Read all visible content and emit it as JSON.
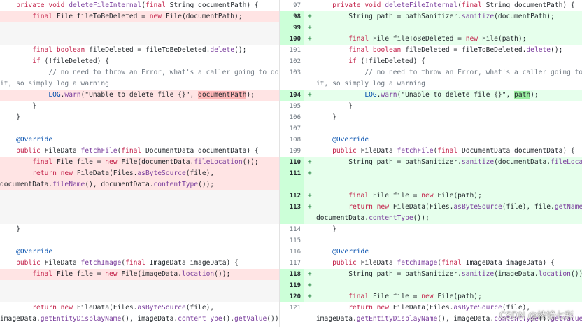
{
  "diff": {
    "left_rows": [
      {
        "type": "context",
        "tokens": [
          {
            "t": "    "
          },
          {
            "t": "private",
            "c": "k"
          },
          {
            "t": " "
          },
          {
            "t": "void",
            "c": "k"
          },
          {
            "t": " "
          },
          {
            "t": "deleteFileInternal",
            "c": "fn"
          },
          {
            "t": "("
          },
          {
            "t": "final",
            "c": "k"
          },
          {
            "t": " String documentPath) {"
          }
        ]
      },
      {
        "type": "removed",
        "tokens": [
          {
            "t": "        "
          },
          {
            "t": "final",
            "c": "k"
          },
          {
            "t": " File fileToBeDeleted = "
          },
          {
            "t": "new",
            "c": "k"
          },
          {
            "t": " File(documentPath);"
          }
        ]
      },
      {
        "type": "filler",
        "tokens": []
      },
      {
        "type": "filler",
        "tokens": []
      },
      {
        "type": "context",
        "tokens": [
          {
            "t": "        "
          },
          {
            "t": "final",
            "c": "k"
          },
          {
            "t": " "
          },
          {
            "t": "boolean",
            "c": "k"
          },
          {
            "t": " fileDeleted = fileToBeDeleted."
          },
          {
            "t": "delete",
            "c": "fn"
          },
          {
            "t": "();"
          }
        ]
      },
      {
        "type": "context",
        "tokens": [
          {
            "t": "        "
          },
          {
            "t": "if",
            "c": "k"
          },
          {
            "t": " (!fileDeleted) {"
          }
        ]
      },
      {
        "type": "context",
        "tokens": [
          {
            "t": "            "
          },
          {
            "t": "// no need to throw an Error, what's a caller going to do about",
            "c": "cm"
          }
        ]
      },
      {
        "type": "context",
        "tokens": [
          {
            "t": "it, so simply log a warning",
            "c": "cm"
          }
        ]
      },
      {
        "type": "removed",
        "tokens": [
          {
            "t": "            "
          },
          {
            "t": "LOG",
            "c": "an"
          },
          {
            "t": "."
          },
          {
            "t": "warn",
            "c": "fn"
          },
          {
            "t": "(\"Unable to delete file {}\", "
          },
          {
            "t": "documentPath",
            "c": "hl-del"
          },
          {
            "t": ");"
          }
        ]
      },
      {
        "type": "context",
        "tokens": [
          {
            "t": "        }"
          }
        ]
      },
      {
        "type": "context",
        "tokens": [
          {
            "t": "    }"
          }
        ]
      },
      {
        "type": "context",
        "tokens": [
          {
            "t": ""
          }
        ]
      },
      {
        "type": "context",
        "tokens": [
          {
            "t": "    "
          },
          {
            "t": "@Override",
            "c": "an"
          }
        ]
      },
      {
        "type": "context",
        "tokens": [
          {
            "t": "    "
          },
          {
            "t": "public",
            "c": "k"
          },
          {
            "t": " FileData "
          },
          {
            "t": "fetchFile",
            "c": "fn"
          },
          {
            "t": "("
          },
          {
            "t": "final",
            "c": "k"
          },
          {
            "t": " DocumentData documentData) {"
          }
        ]
      },
      {
        "type": "removed",
        "tokens": [
          {
            "t": "        "
          },
          {
            "t": "final",
            "c": "k"
          },
          {
            "t": " File file = "
          },
          {
            "t": "new",
            "c": "k"
          },
          {
            "t": " File(documentData."
          },
          {
            "t": "fileLocation",
            "c": "fld"
          },
          {
            "t": "());"
          }
        ]
      },
      {
        "type": "removed",
        "tokens": [
          {
            "t": "        "
          },
          {
            "t": "return",
            "c": "k"
          },
          {
            "t": " "
          },
          {
            "t": "new",
            "c": "k"
          },
          {
            "t": " FileData(Files."
          },
          {
            "t": "asByteSource",
            "c": "fn"
          },
          {
            "t": "(file),"
          }
        ]
      },
      {
        "type": "removed",
        "tokens": [
          {
            "t": "documentData."
          },
          {
            "t": "fileName",
            "c": "fld"
          },
          {
            "t": "(), documentData."
          },
          {
            "t": "contentType",
            "c": "fld"
          },
          {
            "t": "());"
          }
        ]
      },
      {
        "type": "filler",
        "tokens": []
      },
      {
        "type": "filler",
        "tokens": []
      },
      {
        "type": "filler",
        "tokens": []
      },
      {
        "type": "context",
        "tokens": [
          {
            "t": "    }"
          }
        ]
      },
      {
        "type": "context",
        "tokens": [
          {
            "t": ""
          }
        ]
      },
      {
        "type": "context",
        "tokens": [
          {
            "t": "    "
          },
          {
            "t": "@Override",
            "c": "an"
          }
        ]
      },
      {
        "type": "context",
        "tokens": [
          {
            "t": "    "
          },
          {
            "t": "public",
            "c": "k"
          },
          {
            "t": " FileData "
          },
          {
            "t": "fetchImage",
            "c": "fn"
          },
          {
            "t": "("
          },
          {
            "t": "final",
            "c": "k"
          },
          {
            "t": " ImageData imageData) {"
          }
        ]
      },
      {
        "type": "removed",
        "tokens": [
          {
            "t": "        "
          },
          {
            "t": "final",
            "c": "k"
          },
          {
            "t": " File file = "
          },
          {
            "t": "new",
            "c": "k"
          },
          {
            "t": " File(imageData."
          },
          {
            "t": "location",
            "c": "fld"
          },
          {
            "t": "());"
          }
        ]
      },
      {
        "type": "filler",
        "tokens": []
      },
      {
        "type": "filler",
        "tokens": []
      },
      {
        "type": "context",
        "tokens": [
          {
            "t": "        "
          },
          {
            "t": "return",
            "c": "k"
          },
          {
            "t": " "
          },
          {
            "t": "new",
            "c": "k"
          },
          {
            "t": " FileData(Files."
          },
          {
            "t": "asByteSource",
            "c": "fn"
          },
          {
            "t": "(file),"
          }
        ]
      },
      {
        "type": "context",
        "tokens": [
          {
            "t": "imageData."
          },
          {
            "t": "getEntityDisplayName",
            "c": "fn"
          },
          {
            "t": "(), imageData."
          },
          {
            "t": "contentType",
            "c": "fld"
          },
          {
            "t": "()."
          },
          {
            "t": "getValue",
            "c": "fn"
          },
          {
            "t": "());"
          }
        ]
      }
    ],
    "right_rows": [
      {
        "type": "context",
        "line": "97",
        "sign": "",
        "tokens": [
          {
            "t": "    "
          },
          {
            "t": "private",
            "c": "k"
          },
          {
            "t": " "
          },
          {
            "t": "void",
            "c": "k"
          },
          {
            "t": " "
          },
          {
            "t": "deleteFileInternal",
            "c": "fn"
          },
          {
            "t": "("
          },
          {
            "t": "final",
            "c": "k"
          },
          {
            "t": " String documentPath) {"
          }
        ]
      },
      {
        "type": "added",
        "line": "98",
        "sign": "+",
        "tokens": [
          {
            "t": "        String path = pathSanitizer."
          },
          {
            "t": "sanitize",
            "c": "fn"
          },
          {
            "t": "(documentPath);"
          }
        ]
      },
      {
        "type": "added",
        "line": "99",
        "sign": "+",
        "tokens": [
          {
            "t": ""
          }
        ]
      },
      {
        "type": "added",
        "line": "100",
        "sign": "+",
        "tokens": [
          {
            "t": "        "
          },
          {
            "t": "final",
            "c": "k"
          },
          {
            "t": " File fileToBeDeleted = "
          },
          {
            "t": "new",
            "c": "k"
          },
          {
            "t": " File(path);"
          }
        ]
      },
      {
        "type": "context",
        "line": "101",
        "sign": "",
        "tokens": [
          {
            "t": "        "
          },
          {
            "t": "final",
            "c": "k"
          },
          {
            "t": " "
          },
          {
            "t": "boolean",
            "c": "k"
          },
          {
            "t": " fileDeleted = fileToBeDeleted."
          },
          {
            "t": "delete",
            "c": "fn"
          },
          {
            "t": "();"
          }
        ]
      },
      {
        "type": "context",
        "line": "102",
        "sign": "",
        "tokens": [
          {
            "t": "        "
          },
          {
            "t": "if",
            "c": "k"
          },
          {
            "t": " (!fileDeleted) {"
          }
        ]
      },
      {
        "type": "context",
        "line": "103",
        "sign": "",
        "tokens": [
          {
            "t": "            "
          },
          {
            "t": "// no need to throw an Error, what's a caller going to do abo",
            "c": "cm"
          }
        ]
      },
      {
        "type": "context",
        "line": "",
        "sign": "",
        "tokens": [
          {
            "t": "it, so simply log a warning",
            "c": "cm"
          }
        ]
      },
      {
        "type": "added",
        "line": "104",
        "sign": "+",
        "tokens": [
          {
            "t": "            "
          },
          {
            "t": "LOG",
            "c": "an"
          },
          {
            "t": "."
          },
          {
            "t": "warn",
            "c": "fn"
          },
          {
            "t": "(\"Unable to delete file {}\", "
          },
          {
            "t": "path",
            "c": "hl-add"
          },
          {
            "t": ");"
          }
        ]
      },
      {
        "type": "context",
        "line": "105",
        "sign": "",
        "tokens": [
          {
            "t": "        }"
          }
        ]
      },
      {
        "type": "context",
        "line": "106",
        "sign": "",
        "tokens": [
          {
            "t": "    }"
          }
        ]
      },
      {
        "type": "context",
        "line": "107",
        "sign": "",
        "tokens": [
          {
            "t": ""
          }
        ]
      },
      {
        "type": "context",
        "line": "108",
        "sign": "",
        "tokens": [
          {
            "t": "    "
          },
          {
            "t": "@Override",
            "c": "an"
          }
        ]
      },
      {
        "type": "context",
        "line": "109",
        "sign": "",
        "tokens": [
          {
            "t": "    "
          },
          {
            "t": "public",
            "c": "k"
          },
          {
            "t": " FileData "
          },
          {
            "t": "fetchFile",
            "c": "fn"
          },
          {
            "t": "("
          },
          {
            "t": "final",
            "c": "k"
          },
          {
            "t": " DocumentData documentData) {"
          }
        ]
      },
      {
        "type": "added",
        "line": "110",
        "sign": "+",
        "tokens": [
          {
            "t": "        String path = pathSanitizer."
          },
          {
            "t": "sanitize",
            "c": "fn"
          },
          {
            "t": "(documentData."
          },
          {
            "t": "fileLocation",
            "c": "fld"
          },
          {
            "t": "()"
          }
        ]
      },
      {
        "type": "added",
        "line": "111",
        "sign": "+",
        "tokens": [
          {
            "t": ""
          }
        ]
      },
      {
        "type": "added",
        "line": "",
        "sign": "",
        "tokens": [
          {
            "t": ""
          }
        ]
      },
      {
        "type": "added",
        "line": "112",
        "sign": "+",
        "tokens": [
          {
            "t": "        "
          },
          {
            "t": "final",
            "c": "k"
          },
          {
            "t": " File file = "
          },
          {
            "t": "new",
            "c": "k"
          },
          {
            "t": " File(path);"
          }
        ]
      },
      {
        "type": "added",
        "line": "113",
        "sign": "+",
        "tokens": [
          {
            "t": "        "
          },
          {
            "t": "return",
            "c": "k"
          },
          {
            "t": " "
          },
          {
            "t": "new",
            "c": "k"
          },
          {
            "t": " FileData(Files."
          },
          {
            "t": "asByteSource",
            "c": "fn"
          },
          {
            "t": "(file), file."
          },
          {
            "t": "getName",
            "c": "fn"
          },
          {
            "t": "(),"
          }
        ]
      },
      {
        "type": "added",
        "line": "",
        "sign": "",
        "tokens": [
          {
            "t": "documentData."
          },
          {
            "t": "contentType",
            "c": "fld"
          },
          {
            "t": "());"
          }
        ]
      },
      {
        "type": "context",
        "line": "114",
        "sign": "",
        "tokens": [
          {
            "t": "    }"
          }
        ]
      },
      {
        "type": "context",
        "line": "115",
        "sign": "",
        "tokens": [
          {
            "t": ""
          }
        ]
      },
      {
        "type": "context",
        "line": "116",
        "sign": "",
        "tokens": [
          {
            "t": "    "
          },
          {
            "t": "@Override",
            "c": "an"
          }
        ]
      },
      {
        "type": "context",
        "line": "117",
        "sign": "",
        "tokens": [
          {
            "t": "    "
          },
          {
            "t": "public",
            "c": "k"
          },
          {
            "t": " FileData "
          },
          {
            "t": "fetchImage",
            "c": "fn"
          },
          {
            "t": "("
          },
          {
            "t": "final",
            "c": "k"
          },
          {
            "t": " ImageData imageData) {"
          }
        ]
      },
      {
        "type": "added",
        "line": "118",
        "sign": "+",
        "tokens": [
          {
            "t": "        String path = pathSanitizer."
          },
          {
            "t": "sanitize",
            "c": "fn"
          },
          {
            "t": "(imageData."
          },
          {
            "t": "location",
            "c": "fld"
          },
          {
            "t": "());"
          }
        ]
      },
      {
        "type": "added",
        "line": "119",
        "sign": "+",
        "tokens": [
          {
            "t": ""
          }
        ]
      },
      {
        "type": "added",
        "line": "120",
        "sign": "+",
        "tokens": [
          {
            "t": "        "
          },
          {
            "t": "final",
            "c": "k"
          },
          {
            "t": " File file = "
          },
          {
            "t": "new",
            "c": "k"
          },
          {
            "t": " File(path);"
          }
        ]
      },
      {
        "type": "context",
        "line": "121",
        "sign": "",
        "tokens": [
          {
            "t": "        "
          },
          {
            "t": "return",
            "c": "k"
          },
          {
            "t": " "
          },
          {
            "t": "new",
            "c": "k"
          },
          {
            "t": " FileData(Files."
          },
          {
            "t": "asByteSource",
            "c": "fn"
          },
          {
            "t": "(file),"
          }
        ]
      },
      {
        "type": "context",
        "line": "",
        "sign": "",
        "tokens": [
          {
            "t": "imageData."
          },
          {
            "t": "getEntityDisplayName",
            "c": "fn"
          },
          {
            "t": "(), imageData."
          },
          {
            "t": "contentType",
            "c": "fld"
          },
          {
            "t": "()."
          },
          {
            "t": "getValue",
            "c": "fn"
          },
          {
            "t": "());"
          }
        ]
      }
    ]
  },
  "watermark": "CSDN @棱镜七彩",
  "colors": {
    "removed_bg": "#ffe4e4",
    "added_bg": "#e6ffec",
    "added_gutter": "#ccffd8",
    "keyword": "#c3224a",
    "method": "#7a3e9d",
    "annotation": "#0550ae",
    "comment": "#6e7781"
  }
}
